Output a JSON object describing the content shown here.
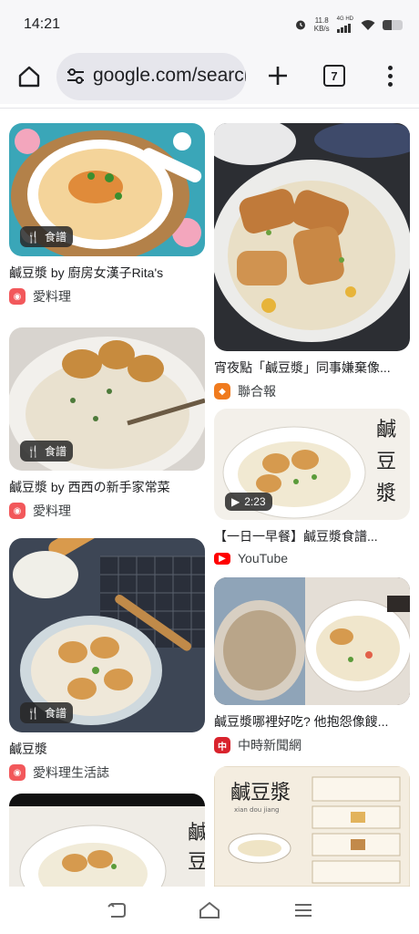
{
  "status_bar": {
    "time": "14:21",
    "speed_value": "11.8",
    "speed_unit": "KB/s",
    "network": "4G HD",
    "battery_level": 0.45
  },
  "toolbar": {
    "url_text": "google.com/search",
    "tab_count": "7"
  },
  "results": [
    {
      "title": "鹹豆漿 by 廚房女漢子Rita's",
      "source": "愛料理",
      "badge": "食譜",
      "fav_color": "#f2585b"
    },
    {
      "title": "鹹豆漿 by 西西の新手家常菜",
      "source": "愛料理",
      "badge": "食譜",
      "fav_color": "#f2585b"
    },
    {
      "title": "鹹豆漿",
      "source": "愛料理生活誌",
      "badge": "食譜",
      "fav_color": "#f2585b"
    },
    {
      "title": "宵夜點「鹹豆漿」同事嫌棄像...",
      "source": "聯合報",
      "fav_color": "#f07b1e"
    },
    {
      "title": "【一日一早餐】鹹豆漿食譜...",
      "source": "YouTube",
      "badge": "2:23",
      "fav_color": "#ff0000"
    },
    {
      "title": "鹹豆漿哪裡好吃? 他抱怨像餿...",
      "source": "中時新聞網",
      "fav_color": "#d9232d"
    }
  ],
  "image_texts": {
    "calligraphy": "鹹豆漿",
    "poster_title": "鹹豆漿",
    "poster_sub": "xian dou jiang"
  },
  "colors": {
    "accent": "#202124",
    "url_bg": "#e6e6ec",
    "toolbar_bg": "#f7f7f9"
  }
}
